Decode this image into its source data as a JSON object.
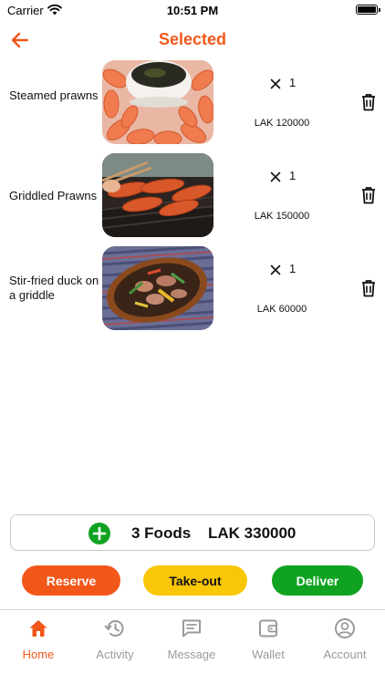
{
  "status_bar": {
    "carrier": "Carrier",
    "time": "10:51 PM"
  },
  "header": {
    "title": "Selected",
    "back_icon": "arrow-left-icon"
  },
  "colors": {
    "accent": "#f2571a",
    "takeout": "#fac707",
    "deliver": "#10a321",
    "inactive_tab": "#9a9a9a"
  },
  "foods": [
    {
      "name": "Steamed prawns",
      "quantity_symbol": "×",
      "quantity": "1",
      "price": "LAK 120000",
      "image": "steamed-prawns-photo"
    },
    {
      "name": "Griddled Prawns",
      "quantity_symbol": "×",
      "quantity": "1",
      "price": "LAK 150000",
      "image": "griddled-prawns-photo"
    },
    {
      "name": "Stir-fried duck on a griddle",
      "quantity_symbol": "×",
      "quantity": "1",
      "price": "LAK 60000",
      "image": "stir-fried-duck-photo"
    }
  ],
  "summary": {
    "count_label": "3 Foods",
    "total_label": "LAK 330000"
  },
  "actions": {
    "reserve": "Reserve",
    "takeout": "Take-out",
    "deliver": "Deliver"
  },
  "tabs": [
    {
      "label": "Home",
      "icon": "home-icon",
      "active": true
    },
    {
      "label": "Activity",
      "icon": "history-icon",
      "active": false
    },
    {
      "label": "Message",
      "icon": "message-icon",
      "active": false
    },
    {
      "label": "Wallet",
      "icon": "wallet-icon",
      "active": false
    },
    {
      "label": "Account",
      "icon": "account-icon",
      "active": false
    }
  ]
}
